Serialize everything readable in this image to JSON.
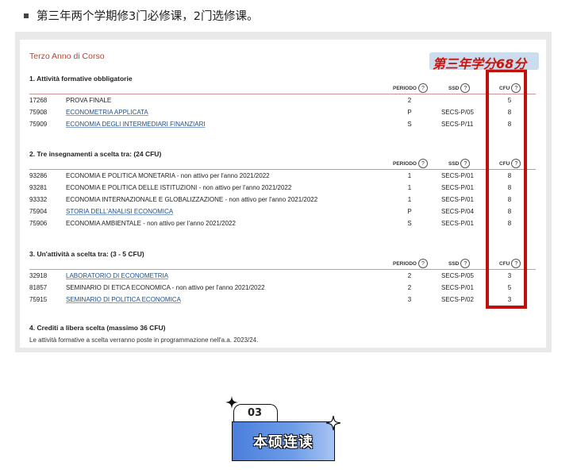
{
  "intro": {
    "text": "第三年两个学期修3门必修课，2门选修课。"
  },
  "annotation": "第三年学分68分",
  "header_labels": {
    "periodo": "PERIODO",
    "ssd": "SSD",
    "cfu": "CFU",
    "help": "?"
  },
  "year_title": "Terzo Anno di Corso",
  "sections": [
    {
      "title": "1. Attività formative obbligatorie",
      "rows": [
        {
          "code": "17268",
          "name": "PROVA FINALE",
          "periodo": "2",
          "ssd": "",
          "cfu": "5"
        },
        {
          "code": "75908",
          "name": "ECONOMETRIA APPLICATA",
          "periodo": "P",
          "ssd": "SECS-P/05",
          "cfu": "8"
        },
        {
          "code": "75909",
          "name": "ECONOMIA DEGLI INTERMEDIARI FINANZIARI",
          "periodo": "S",
          "ssd": "SECS-P/11",
          "cfu": "8"
        }
      ]
    },
    {
      "title": "2. Tre insegnamenti a scelta tra: (24 CFU)",
      "rows": [
        {
          "code": "93286",
          "name": "ECONOMIA E POLITICA MONETARIA - non attivo per l'anno  2021/2022",
          "periodo": "1",
          "ssd": "SECS-P/01",
          "cfu": "8"
        },
        {
          "code": "93281",
          "name": "ECONOMIA E POLITICA DELLE ISTITUZIONI - non attivo per l'anno  2021/2022",
          "periodo": "1",
          "ssd": "SECS-P/01",
          "cfu": "8"
        },
        {
          "code": "93332",
          "name": "ECONOMIA INTERNAZIONALE E GLOBALIZZAZIONE - non attivo per l'anno  2021/2022",
          "periodo": "1",
          "ssd": "SECS-P/01",
          "cfu": "8"
        },
        {
          "code": "75904",
          "name": "STORIA DELL'ANALISI ECONOMICA",
          "periodo": "P",
          "ssd": "SECS-P/04",
          "cfu": "8"
        },
        {
          "code": "75906",
          "name": "ECONOMIA AMBIENTALE - non attivo per l'anno  2021/2022",
          "periodo": "S",
          "ssd": "SECS-P/01",
          "cfu": "8"
        }
      ]
    },
    {
      "title": "3. Un'attività a scelta tra: (3 - 5 CFU)",
      "rows": [
        {
          "code": "32918",
          "name": "LABORATORIO DI ECONOMETRIA",
          "periodo": "2",
          "ssd": "SECS-P/05",
          "cfu": "3"
        },
        {
          "code": "81857",
          "name": "SEMINARIO DI ETICA ECONOMICA - non attivo per l'anno  2021/2022",
          "periodo": "2",
          "ssd": "SECS-P/01",
          "cfu": "5"
        },
        {
          "code": "75915",
          "name": "SEMINARIO DI POLITICA ECONOMICA",
          "periodo": "3",
          "ssd": "SECS-P/02",
          "cfu": "3"
        }
      ]
    }
  ],
  "section4": {
    "title": "4. Crediti a libera scelta (massimo 36 CFU)",
    "text": "Le attività formative a scelta verranno poste in programmazione nell'a.a. 2023/24."
  },
  "badge": {
    "number": "03",
    "label": "本硕连读"
  }
}
